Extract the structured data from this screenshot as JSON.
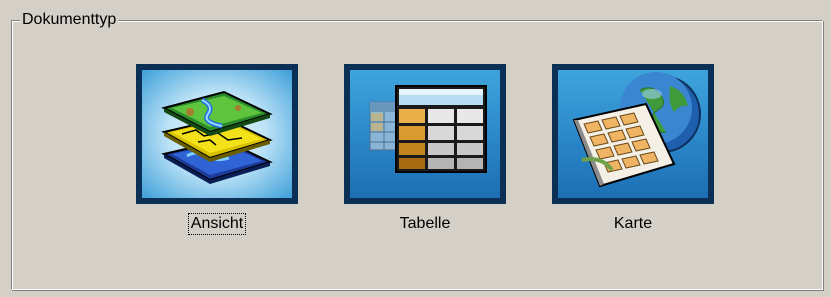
{
  "group": {
    "title": "Dokumenttyp"
  },
  "options": [
    {
      "label": "Ansicht",
      "icon": "layers-map-icon",
      "focused": true
    },
    {
      "label": "Tabelle",
      "icon": "table-icon",
      "focused": false
    },
    {
      "label": "Karte",
      "icon": "globe-map-icon",
      "focused": false
    }
  ],
  "colors": {
    "window_bg": "#d4d0c8",
    "tile_border": "#0b2f55",
    "tile_blue": "#2a86c8"
  }
}
